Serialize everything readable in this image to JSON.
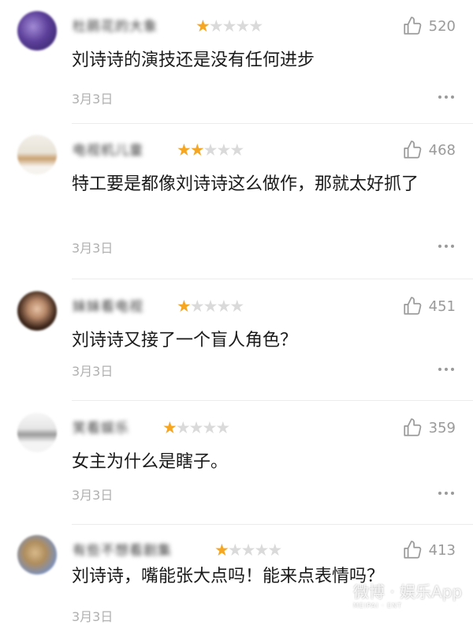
{
  "colors": {
    "star_on": "#f5a623",
    "star_off": "#dadada",
    "like_icon": "#9a9a9a",
    "date_text": "#b0b0b0"
  },
  "reviews": [
    {
      "username": "杜鹃花的大象",
      "rating": 1,
      "likes": "520",
      "comment": "刘诗诗的演技还是没有任何进步",
      "date": "3月3日"
    },
    {
      "username": "电视机儿童",
      "rating": 2,
      "likes": "468",
      "comment": "特工要是都像刘诗诗这么做作，那就太好抓了",
      "date": "3月3日"
    },
    {
      "username": "妹妹看电视",
      "rating": 1,
      "likes": "451",
      "comment": "刘诗诗又接了一个盲人角色？",
      "date": "3月3日"
    },
    {
      "username": "笑看娱乐",
      "rating": 1,
      "likes": "359",
      "comment": "女主为什么是瞎子。",
      "date": "3月3日"
    },
    {
      "username": "有些不想看剧集",
      "rating": 1,
      "likes": "413",
      "comment": "刘诗诗，嘴能张大点吗！能来点表情吗？",
      "date": "3月3日"
    }
  ],
  "icons": {
    "like": "thumbs-up-icon",
    "more": "more-dots-icon"
  }
}
